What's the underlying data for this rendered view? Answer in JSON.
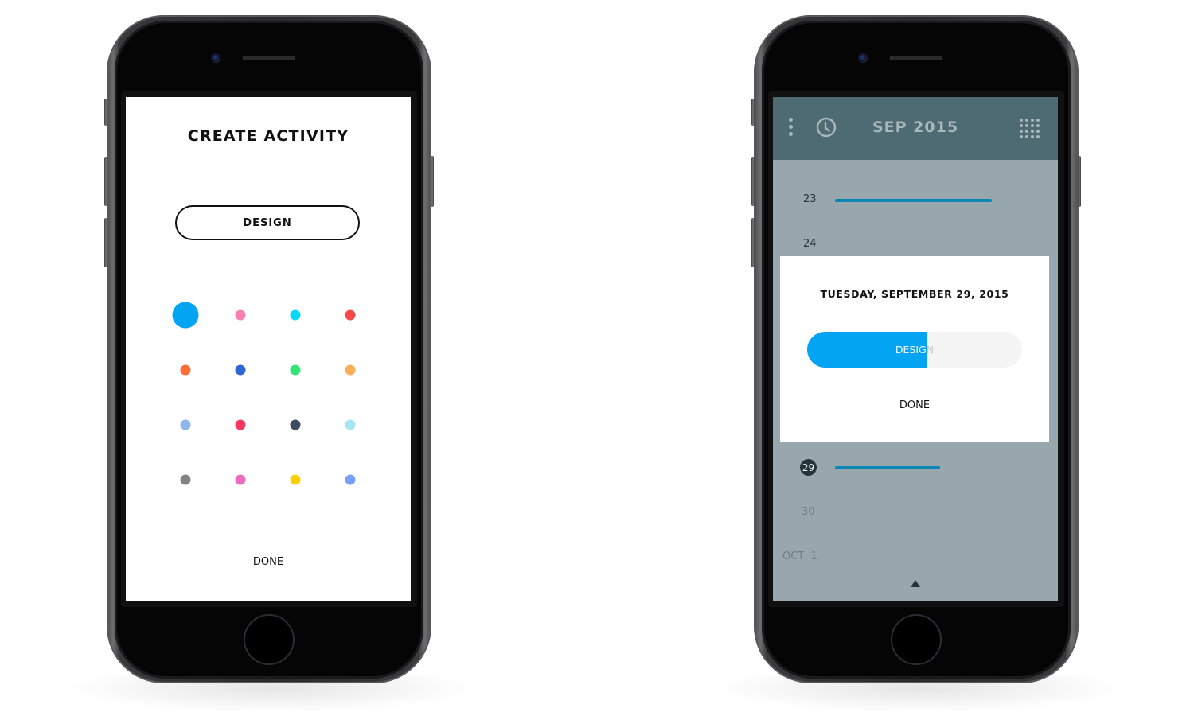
{
  "create_activity": {
    "title": "CREATE ACTIVITY",
    "activity_name": "DESIGN",
    "selected_color_index": 0,
    "colors": [
      "#03a5f3",
      "#f97fb1",
      "#0ad8f8",
      "#f4494a",
      "#fd6d35",
      "#3066d3",
      "#30e573",
      "#fdae5a",
      "#8fb6e8",
      "#fb3865",
      "#3d4b61",
      "#a5e6f3",
      "#858282",
      "#ec6cc0",
      "#ffd000",
      "#7a9ef6"
    ],
    "done_label": "DONE"
  },
  "calendar": {
    "header": {
      "menu_icon": "vertical-dots-icon",
      "history_icon": "clock-icon",
      "month_label": "SEP 2015",
      "grid_icon": "dot-grid-icon"
    },
    "days": [
      {
        "label": "23",
        "has_activity": true,
        "activity_progress": 0.72
      },
      {
        "label": "24",
        "has_activity": false
      },
      {
        "label": "29",
        "today": true,
        "has_activity": true,
        "activity_progress": 0.48
      },
      {
        "label": "30",
        "has_activity": false,
        "muted": true
      },
      {
        "label": "OCT  1",
        "has_activity": false,
        "muted": true
      }
    ],
    "accent_color": "#0b86b4",
    "scroll_indicator": "up-triangle-icon",
    "modal": {
      "date_title": "TUESDAY, SEPTEMBER 29, 2015",
      "activity_label": "DESIGN",
      "activity_fill_color": "#03a5f3",
      "activity_progress": 0.56,
      "done_label": "DONE"
    }
  }
}
